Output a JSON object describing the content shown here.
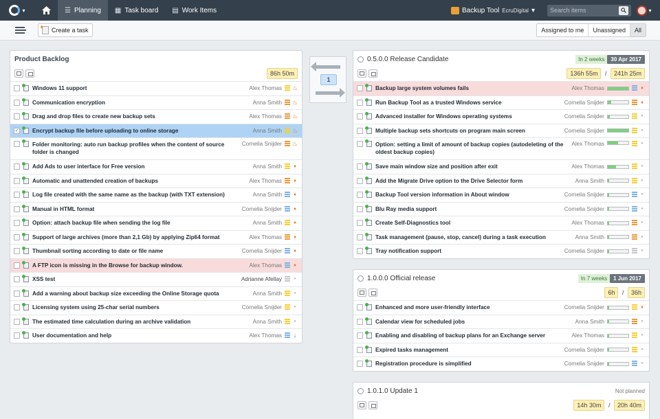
{
  "nav": {
    "planning": "Planning",
    "taskboard": "Task board",
    "workitems": "Work Items",
    "project": "Backup Tool",
    "org": "EcruDigital",
    "search_placeholder": "Search items"
  },
  "toolbar": {
    "create_task": "Create a task",
    "assigned_to_me": "Assigned to me",
    "unassigned": "Unassigned",
    "all": "All"
  },
  "backlog": {
    "title": "Product Backlog",
    "estimate": "86h 50m",
    "items": [
      {
        "title": "Windows 11 support",
        "assignee": "Alex Thomas",
        "prio": "yellow",
        "flag": "fire",
        "state": ""
      },
      {
        "title": "Communication encryption",
        "assignee": "Anna Smith",
        "prio": "orange",
        "flag": "fire",
        "state": ""
      },
      {
        "title": "Drag and drop files to create new backup sets",
        "assignee": "Alex Thomas",
        "prio": "orange",
        "flag": "fire",
        "state": ""
      },
      {
        "title": "Encrypt backup file before uploading to online storage",
        "assignee": "Anna Smith",
        "prio": "yellow",
        "flag": "fire",
        "state": "selected"
      },
      {
        "title": "Folder monitoring: auto run backup profiles when the content of source folder is changed",
        "assignee": "Cornelia Snijder",
        "prio": "orange",
        "flag": "fire",
        "state": "tall"
      },
      {
        "title": "Add Ads to user interface for Free version",
        "assignee": "Anna Smith",
        "prio": "yellow",
        "flag": "drop",
        "state": ""
      },
      {
        "title": "Automatic and unattended creation of backups",
        "assignee": "Alex Thomas",
        "prio": "orange",
        "flag": "drop",
        "state": ""
      },
      {
        "title": "Log file created with the same name as the backup (with TXT extension)",
        "assignee": "Anna Smith",
        "prio": "blue",
        "flag": "drop",
        "state": ""
      },
      {
        "title": "Manual in HTML format",
        "assignee": "Cornelia Snijder",
        "prio": "blue",
        "flag": "drop",
        "state": ""
      },
      {
        "title": "Option: attach backup file when sending the log file",
        "assignee": "Anna Smith",
        "prio": "yellow",
        "flag": "drop",
        "state": ""
      },
      {
        "title": "Support of large archives (more than 2,1 Gb) by applying Zip64 format",
        "assignee": "Alex Thomas",
        "prio": "orange",
        "flag": "drop",
        "state": ""
      },
      {
        "title": "Thumbnail sorting according to date or file name",
        "assignee": "Cornelia Snijder",
        "prio": "blue",
        "flag": "drop",
        "state": ""
      },
      {
        "title": "A FTP icon is missing in the Browse for backup window.",
        "assignee": "Alex Thomas",
        "prio": "blue",
        "flag": "drop",
        "state": "warn"
      },
      {
        "title": "XSS test",
        "assignee": "Adrianne Afellay",
        "prio": "gray",
        "flag": "dot",
        "state": "strong"
      },
      {
        "title": "Add a warning about backup size exceeding the Online Storage quota",
        "assignee": "Anna Smith",
        "prio": "yellow",
        "flag": "dot",
        "state": ""
      },
      {
        "title": "Licensing system using 25-char serial numbers",
        "assignee": "Cornelia Snijder",
        "prio": "yellow",
        "flag": "dot",
        "state": ""
      },
      {
        "title": "The estimated time calculation during an archive validation",
        "assignee": "Anna Smith",
        "prio": "yellow",
        "flag": "dot",
        "state": ""
      },
      {
        "title": "User documentation and help",
        "assignee": "Alex Thomas",
        "prio": "blue",
        "flag": "down",
        "state": ""
      }
    ]
  },
  "swap": {
    "count": "1"
  },
  "release1": {
    "version": "0.5.0.0",
    "name": "Release Candidate",
    "status": "In 2 weeks",
    "date": "30 Apr 2017",
    "estimate": "136h 55m",
    "capacity": "241h 25m",
    "items": [
      {
        "title": "Backup large system volumes fails",
        "assignee": "Alex Thomas",
        "progress": 1.0,
        "prio": "blue",
        "flag": "drop",
        "state": "warn"
      },
      {
        "title": "Run Backup Tool as a trusted Windows service",
        "assignee": "Cornelia Snijder",
        "progress": 0.15,
        "prio": "orange",
        "flag": "drop",
        "state": ""
      },
      {
        "title": "Advanced installer for Windows operating systems",
        "assignee": "Cornelia Snijder",
        "progress": 0.1,
        "prio": "yellow",
        "flag": "dot",
        "state": ""
      },
      {
        "title": "Multiple backup sets shortcuts on program main screen",
        "assignee": "Cornelia Snijder",
        "progress": 1.0,
        "prio": "yellow",
        "flag": "dot",
        "state": ""
      },
      {
        "title": "Option: setting a limit of amount of backup copies (autodeleting of the oldest backup copies)",
        "assignee": "Alex Thomas",
        "progress": 0.5,
        "prio": "yellow",
        "flag": "dot",
        "state": "tall"
      },
      {
        "title": "Save main window size and position after exit",
        "assignee": "Alex Thomas",
        "progress": 0.4,
        "prio": "yellow",
        "flag": "dot",
        "state": ""
      },
      {
        "title": "Add the Migrate Drive option to the Drive Selector form",
        "assignee": "Anna Smith",
        "progress": 0.05,
        "prio": "yellow",
        "flag": "dot",
        "state": ""
      },
      {
        "title": "Backup Tool version information in About window",
        "assignee": "Cornelia Snijder",
        "progress": 0.05,
        "prio": "blue",
        "flag": "dot",
        "state": ""
      },
      {
        "title": "Blu Ray media support",
        "assignee": "Cornelia Snijder",
        "progress": 0.05,
        "prio": "blue",
        "flag": "dot",
        "state": ""
      },
      {
        "title": "Create Self-Diagnostics tool",
        "assignee": "Alex Thomas",
        "progress": 0.05,
        "prio": "orange",
        "flag": "dot",
        "state": ""
      },
      {
        "title": "Task management (pause, stop, cancel) during a task execution",
        "assignee": "Anna Smith",
        "progress": 0.05,
        "prio": "orange",
        "flag": "dot",
        "state": ""
      },
      {
        "title": "Tray notification support",
        "assignee": "Cornelia Snijder",
        "progress": 0.05,
        "prio": "gray",
        "flag": "dot",
        "state": ""
      }
    ]
  },
  "release2": {
    "version": "1.0.0.0",
    "name": "Official release",
    "status": "In 7 weeks",
    "date": "1 Jun 2017",
    "estimate": "6h",
    "capacity": "36h",
    "items": [
      {
        "title": "Enhanced and more user-friendly interface",
        "assignee": "Cornelia Snijder",
        "progress": 0.05,
        "prio": "yellow",
        "flag": "drop",
        "state": ""
      },
      {
        "title": "Calendar view for scheduled jobs",
        "assignee": "Anna Smith",
        "progress": 0.05,
        "prio": "orange",
        "flag": "dot",
        "state": ""
      },
      {
        "title": "Enabling and disabling of backup plans for an Exchange server",
        "assignee": "Alex Thomas",
        "progress": 0.05,
        "prio": "yellow",
        "flag": "dot",
        "state": ""
      },
      {
        "title": "Expired tasks management",
        "assignee": "Cornelia Snijder",
        "progress": 0.05,
        "prio": "yellow",
        "flag": "dot",
        "state": ""
      },
      {
        "title": "Registration procedure is simplified",
        "assignee": "Cornelia Snijder",
        "progress": 0.05,
        "prio": "blue",
        "flag": "dot",
        "state": ""
      }
    ]
  },
  "release3": {
    "version": "1.0.1.0",
    "name": "Update 1",
    "status": "Not planned",
    "estimate": "14h 30m",
    "capacity": "20h 40m"
  },
  "colors": {
    "topbar": "#34404b",
    "prio_yellow": "#f2cf3a",
    "prio_orange": "#e89a3c",
    "prio_blue": "#7fb2df",
    "prio_gray": "#c2c6ca",
    "flag_fire": "#e8752a",
    "flag_down": "#3b7dd8",
    "progress": "#7ed07e"
  }
}
